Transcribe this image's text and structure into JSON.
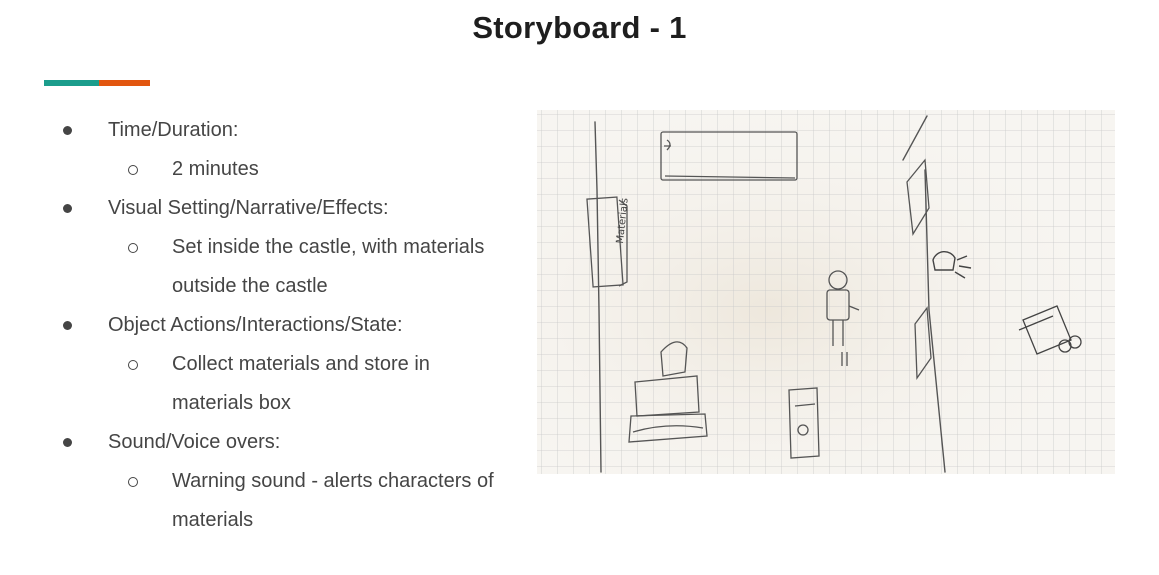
{
  "slide": {
    "title": "Storyboard - 1",
    "bullets": [
      {
        "level": 1,
        "text": "Time/Duration:"
      },
      {
        "level": 2,
        "text": "2 minutes"
      },
      {
        "level": 1,
        "text": "Visual Setting/Narrative/Effects:"
      },
      {
        "level": 2,
        "text": "Set inside the castle, with materials"
      },
      {
        "level": 3,
        "text": "outside the castle"
      },
      {
        "level": 1,
        "text": "Object Actions/Interactions/State:"
      },
      {
        "level": 2,
        "text": "Collect materials and store in"
      },
      {
        "level": 3,
        "text": "materials box"
      },
      {
        "level": 1,
        "text": "Sound/Voice overs:"
      },
      {
        "level": 2,
        "text": "Warning sound - alerts characters of"
      },
      {
        "level": 3,
        "text": "materials"
      }
    ]
  },
  "sketch": {
    "box_label": "Materials"
  },
  "colors": {
    "accent_teal": "#1b9d8c",
    "accent_orange": "#e2560f"
  }
}
